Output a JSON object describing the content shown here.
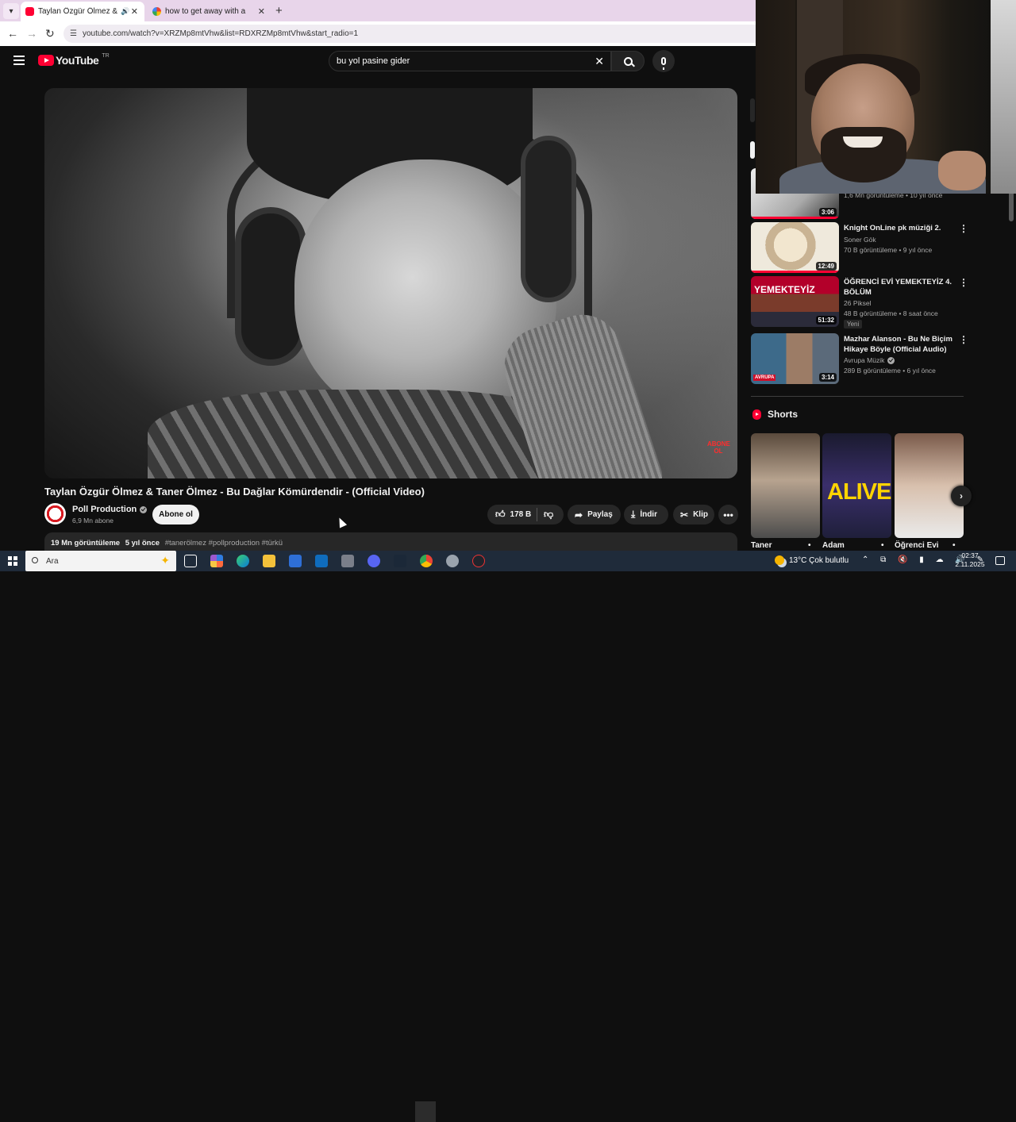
{
  "browser": {
    "tabs": [
      {
        "title": "Taylan Özgür Ölmez & Tane",
        "audio": "🔊",
        "close": "✕"
      },
      {
        "title": "how to get away with a murder",
        "close": "✕"
      }
    ],
    "new_tab": "+",
    "url": "youtube.com/watch?v=XRZMp8mtVhw&list=RDXRZMp8mtVhw&start_radio=1"
  },
  "youtube": {
    "logo_text": "YouTube",
    "country_code": "TR",
    "search_value": "bu yol pasine gider",
    "clear_icon": "✕"
  },
  "video": {
    "stamp": "ABONE OL",
    "title": "Taylan Özgür Ölmez & Taner Ölmez - Bu Dağlar Kömürdendir - (Official Video)",
    "channel_name": "Poll Production",
    "subscribers": "6,9 Mn abone",
    "subscribe_label": "Abone ol",
    "likes": "178 B",
    "share_label": "Paylaş",
    "download_label": "İndir",
    "clip_label": "Klip",
    "more_label": "•••",
    "views": "19 Mn görüntüleme",
    "age": "5 yıl önce",
    "tags": "#tanerölmez #pollproduction #türkü"
  },
  "sidebar": {
    "partial_meta": "1,6 Mn görüntüleme • 10 yıl önce",
    "items": [
      {
        "title": "",
        "duration": "3:06",
        "channel": "",
        "meta": ""
      },
      {
        "title": "Knight OnLine pk müziği 2.",
        "channel": "Soner Gök",
        "meta": "70 B görüntüleme • 9 yıl önce",
        "duration": "12:49",
        "thumb_text": ""
      },
      {
        "title": "ÖĞRENCİ EVİ YEMEKTEYİZ 4. BÖLÜM",
        "channel": "26 Piksel",
        "meta": "48 B görüntüleme • 8 saat önce",
        "badge": "Yeni",
        "duration": "51:32",
        "thumb_text": "YEMEKTEYİZ"
      },
      {
        "title": "Mazhar Alanson - Bu Ne Biçim Hikaye Böyle (Official Audio)",
        "channel": "Avrupa Müzik",
        "meta": "289 B görüntüleme • 6 yıl önce",
        "duration": "3:14",
        "thumb_text": "AVRUPA"
      }
    ],
    "kebab": "⋮",
    "shorts_title": "Shorts",
    "shorts": [
      {
        "label": "Taner",
        "overlay": ""
      },
      {
        "label": "Adam",
        "overlay": "ALIVE"
      },
      {
        "label": "Öğrenci Evi",
        "overlay": ""
      }
    ],
    "next_icon": "›"
  },
  "taskbar": {
    "search_placeholder": "Ara",
    "weather": "13°C  Çok bulutlu",
    "tray": "⌃ ⧉ 🔇 ▮ ☁ 🔊 ✎",
    "time": "02:37",
    "date": "2.11.2025"
  }
}
